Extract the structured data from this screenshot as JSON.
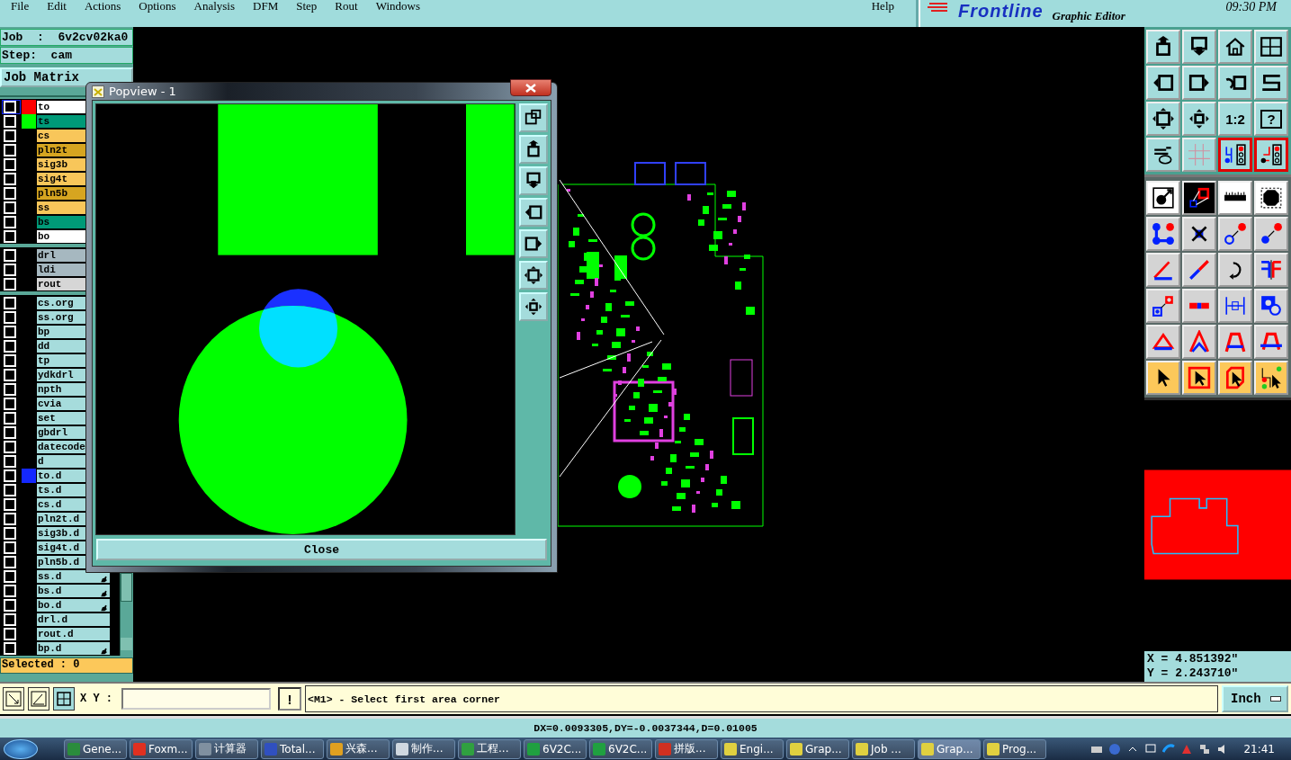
{
  "menu": {
    "items": [
      "File",
      "Edit",
      "Actions",
      "Options",
      "Analysis",
      "DFM",
      "Step",
      "Rout",
      "Windows"
    ],
    "help": "Help"
  },
  "brand": {
    "logo": "Frontline",
    "subtitle": "Graphic Editor",
    "time": "09:30 PM"
  },
  "job": {
    "job_label": "Job  :  6v2cv02ka0",
    "step_label": "Step:  cam",
    "matrix_button": "Job Matrix"
  },
  "layer_groups": [
    [
      {
        "name": "to",
        "kind": "silk",
        "color": "#ff0000",
        "selected": true,
        "checked": false
      },
      {
        "name": "ts",
        "kind": "mask",
        "color": "#00ff00",
        "selected": false,
        "checked": false
      },
      {
        "name": "cs",
        "kind": "signal",
        "selected": false,
        "checked": false
      },
      {
        "name": "pln2t",
        "kind": "power",
        "selected": false,
        "checked": false
      },
      {
        "name": "sig3b",
        "kind": "signal",
        "selected": false,
        "checked": false
      },
      {
        "name": "sig4t",
        "kind": "signal",
        "selected": false,
        "checked": false
      },
      {
        "name": "pln5b",
        "kind": "power",
        "selected": false,
        "checked": false
      },
      {
        "name": "ss",
        "kind": "signal",
        "selected": false,
        "checked": false
      },
      {
        "name": "bs",
        "kind": "mask",
        "selected": false,
        "checked": false
      },
      {
        "name": "bo",
        "kind": "silk",
        "selected": false,
        "checked": false
      }
    ],
    [
      {
        "name": "drl",
        "kind": "drill",
        "selected": false,
        "checked": false
      },
      {
        "name": "ldi",
        "kind": "drill",
        "selected": false,
        "checked": false
      },
      {
        "name": "rout",
        "kind": "rout",
        "selected": false,
        "checked": false
      }
    ],
    [
      {
        "name": "cs.org",
        "kind": "misc",
        "selected": false,
        "checked": false
      },
      {
        "name": "ss.org",
        "kind": "misc",
        "selected": false,
        "checked": false
      },
      {
        "name": "bp",
        "kind": "misc",
        "selected": false,
        "checked": false
      },
      {
        "name": "dd",
        "kind": "misc",
        "selected": false,
        "checked": false
      },
      {
        "name": "tp",
        "kind": "misc",
        "selected": false,
        "checked": false
      },
      {
        "name": "ydkdrl",
        "kind": "misc",
        "selected": false,
        "checked": false
      },
      {
        "name": "npth",
        "kind": "misc",
        "selected": false,
        "checked": false
      },
      {
        "name": "cvia",
        "kind": "misc",
        "selected": false,
        "checked": false
      },
      {
        "name": "set",
        "kind": "misc",
        "selected": false,
        "checked": false
      },
      {
        "name": "gbdrl",
        "kind": "misc",
        "selected": false,
        "checked": false
      },
      {
        "name": "datecode",
        "kind": "misc",
        "selected": false,
        "checked": false
      },
      {
        "name": "d",
        "kind": "misc",
        "selected": false,
        "checked": false
      },
      {
        "name": "to.d",
        "kind": "misc",
        "color": "#1428ff",
        "selected": false,
        "checked": false
      },
      {
        "name": "ts.d",
        "kind": "misc",
        "selected": false,
        "checked": false
      },
      {
        "name": "cs.d",
        "kind": "misc",
        "selected": false,
        "checked": false
      },
      {
        "name": "pln2t.d",
        "kind": "misc",
        "selected": false,
        "checked": false
      },
      {
        "name": "sig3b.d",
        "kind": "misc",
        "selected": false,
        "checked": false
      },
      {
        "name": "sig4t.d",
        "kind": "misc",
        "selected": false,
        "checked": false
      },
      {
        "name": "pln5b.d",
        "kind": "misc",
        "selected": false,
        "checked": false
      },
      {
        "name": "ss.d",
        "kind": "misc",
        "selected": false,
        "checked": false,
        "marked": true
      },
      {
        "name": "bs.d",
        "kind": "misc",
        "selected": false,
        "checked": false,
        "marked": true
      },
      {
        "name": "bo.d",
        "kind": "misc",
        "selected": false,
        "checked": false,
        "marked": true
      },
      {
        "name": "drl.d",
        "kind": "misc",
        "selected": false,
        "checked": false,
        "marked": false
      },
      {
        "name": "rout.d",
        "kind": "misc",
        "selected": false,
        "checked": false,
        "marked": false
      },
      {
        "name": "bp.d",
        "kind": "misc",
        "selected": false,
        "checked": false,
        "marked": true
      }
    ]
  ],
  "selected_count": "Selected : 0",
  "popview": {
    "title": "Popview - 1",
    "close_button": "Close"
  },
  "toolbar": [
    {
      "kind": "cyan",
      "active": false
    },
    {
      "kind": "cyan",
      "active": false
    },
    {
      "kind": "cyan",
      "active": false
    },
    {
      "kind": "cyan",
      "active": false
    },
    {
      "kind": "cyan",
      "active": false
    },
    {
      "kind": "cyan",
      "active": false
    },
    {
      "kind": "cyan",
      "active": false
    },
    {
      "kind": "cyan",
      "active": false
    },
    {
      "kind": "cyan",
      "active": false
    },
    {
      "kind": "cyan",
      "active": false
    },
    {
      "kind": "cyan",
      "active": false,
      "label": "1:2"
    },
    {
      "kind": "cyan",
      "active": false,
      "label": "?"
    },
    {
      "kind": "cyan",
      "active": false
    },
    {
      "kind": "cyan",
      "active": false
    },
    {
      "kind": "cyan",
      "active": true
    },
    {
      "kind": "cyan",
      "active": true
    },
    {
      "kind": "white",
      "active": false
    },
    {
      "kind": "dark",
      "active": false
    },
    {
      "kind": "white",
      "active": false
    },
    {
      "kind": "white",
      "active": false
    },
    {
      "kind": "gray",
      "active": false
    },
    {
      "kind": "gray",
      "active": false
    },
    {
      "kind": "gray",
      "active": false
    },
    {
      "kind": "gray",
      "active": false
    },
    {
      "kind": "gray",
      "active": false
    },
    {
      "kind": "gray",
      "active": false
    },
    {
      "kind": "gray",
      "active": false
    },
    {
      "kind": "gray",
      "active": false
    },
    {
      "kind": "gray",
      "active": false
    },
    {
      "kind": "gray",
      "active": false
    },
    {
      "kind": "gray",
      "active": false
    },
    {
      "kind": "gray",
      "active": false
    },
    {
      "kind": "gray",
      "active": false
    },
    {
      "kind": "gray",
      "active": false
    },
    {
      "kind": "gray",
      "active": false
    },
    {
      "kind": "gray",
      "active": false
    },
    {
      "kind": "orange",
      "active": false
    },
    {
      "kind": "orange",
      "active": false
    },
    {
      "kind": "orange",
      "active": false
    },
    {
      "kind": "orange",
      "active": false
    }
  ],
  "coordinates": {
    "x": "X = 4.851392\"",
    "y": "Y = 2.243710\""
  },
  "command_bar": {
    "xy_label": "X Y :",
    "bang_button": "!",
    "message": "<M1> - Select first area corner",
    "units": "Inch"
  },
  "status_line": "DX=0.0093305,DY=-0.0037344,D=0.01005",
  "taskbar": {
    "items": [
      {
        "label": "Gene...",
        "color": "#2a8c3c",
        "selected": false
      },
      {
        "label": "Foxm...",
        "color": "#e03020",
        "selected": false
      },
      {
        "label": "计算器",
        "color": "#8090a0",
        "selected": false
      },
      {
        "label": "Total...",
        "color": "#3050c0",
        "selected": false
      },
      {
        "label": "兴森...",
        "color": "#e0a020",
        "selected": false
      },
      {
        "label": "制作...",
        "color": "#d0d8e0",
        "selected": false
      },
      {
        "label": "工程...",
        "color": "#30a040",
        "selected": false
      },
      {
        "label": "6V2C...",
        "color": "#20a040",
        "selected": false
      },
      {
        "label": "6V2C...",
        "color": "#20a040",
        "selected": false
      },
      {
        "label": "拼版...",
        "color": "#d03020",
        "selected": false
      },
      {
        "label": "Engi...",
        "color": "#e0d040",
        "selected": false
      },
      {
        "label": "Grap...",
        "color": "#e0d040",
        "selected": false
      },
      {
        "label": "Job ...",
        "color": "#e0d040",
        "selected": false
      },
      {
        "label": "Grap...",
        "color": "#e0d040",
        "selected": true
      },
      {
        "label": "Prog...",
        "color": "#e0d040",
        "selected": false
      }
    ],
    "clock": "21:41"
  }
}
